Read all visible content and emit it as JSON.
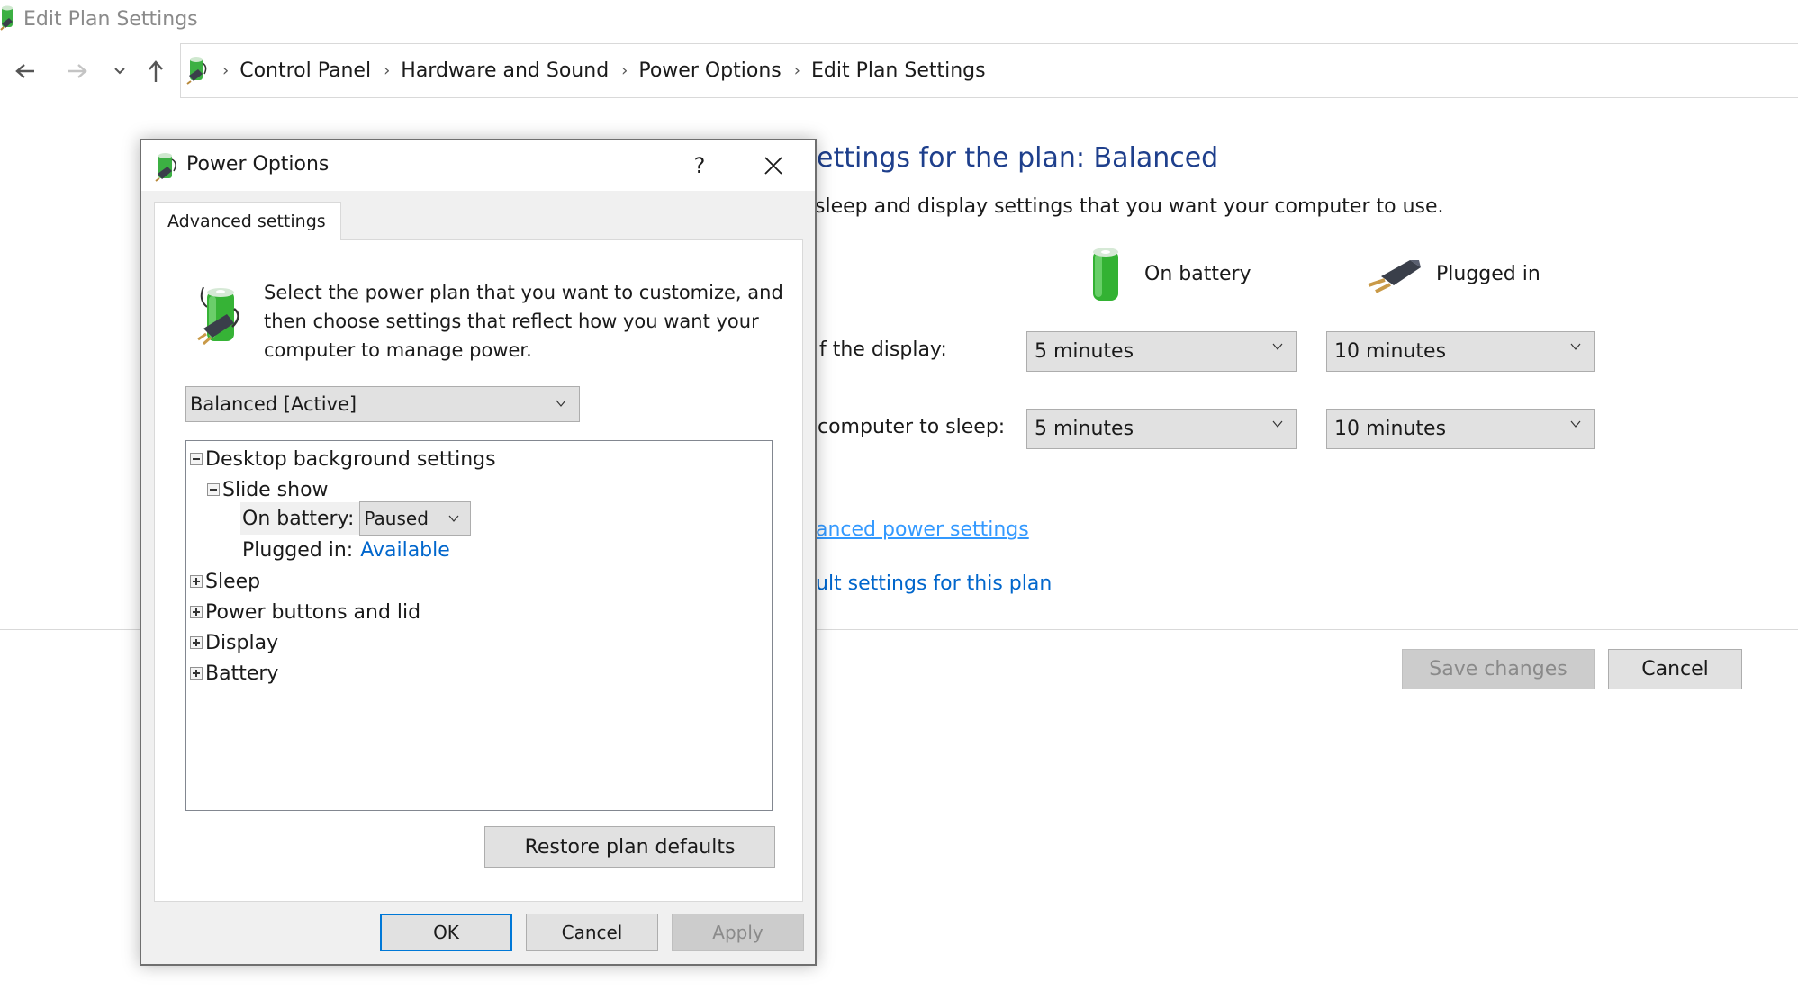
{
  "window": {
    "title": "Edit Plan Settings"
  },
  "nav": {
    "back_icon": "arrow-left-icon",
    "forward_icon": "arrow-right-icon",
    "recent_icon": "chevron-down-icon",
    "up_icon": "arrow-up-icon",
    "breadcrumb": [
      "Control Panel",
      "Hardware and Sound",
      "Power Options",
      "Edit Plan Settings"
    ]
  },
  "main": {
    "heading": "ettings for the plan: Balanced",
    "subheading": "sleep and display settings that you want your computer to use.",
    "columns": {
      "on_battery": "On battery",
      "plugged_in": "Plugged in"
    },
    "rows": [
      {
        "label": "f the display:",
        "on_battery": "5 minutes",
        "plugged_in": "10 minutes"
      },
      {
        "label": "computer to sleep:",
        "on_battery": "5 minutes",
        "plugged_in": "10 minutes"
      }
    ],
    "links": {
      "advanced": "anced power settings",
      "restore": "ult settings for this plan"
    },
    "buttons": {
      "save": "Save changes",
      "cancel": "Cancel"
    },
    "colors": {
      "heading": "#1e3f8c",
      "link": "#0066cc"
    }
  },
  "dialog": {
    "title": "Power Options",
    "help": "?",
    "tab": "Advanced settings",
    "description": "Select the power plan that you want to customize, and then choose settings that reflect how you want your computer to manage power.",
    "plan_select": "Balanced [Active]",
    "tree": {
      "desktop_bg": "Desktop background settings",
      "slide_show": "Slide show",
      "on_battery_label": "On battery:",
      "on_battery_value": "Paused",
      "plugged_in_label": "Plugged in:",
      "plugged_in_value": "Available",
      "sleep": "Sleep",
      "power_buttons": "Power buttons and lid",
      "display": "Display",
      "battery": "Battery"
    },
    "restore_button": "Restore plan defaults",
    "buttons": {
      "ok": "OK",
      "cancel": "Cancel",
      "apply": "Apply"
    }
  }
}
